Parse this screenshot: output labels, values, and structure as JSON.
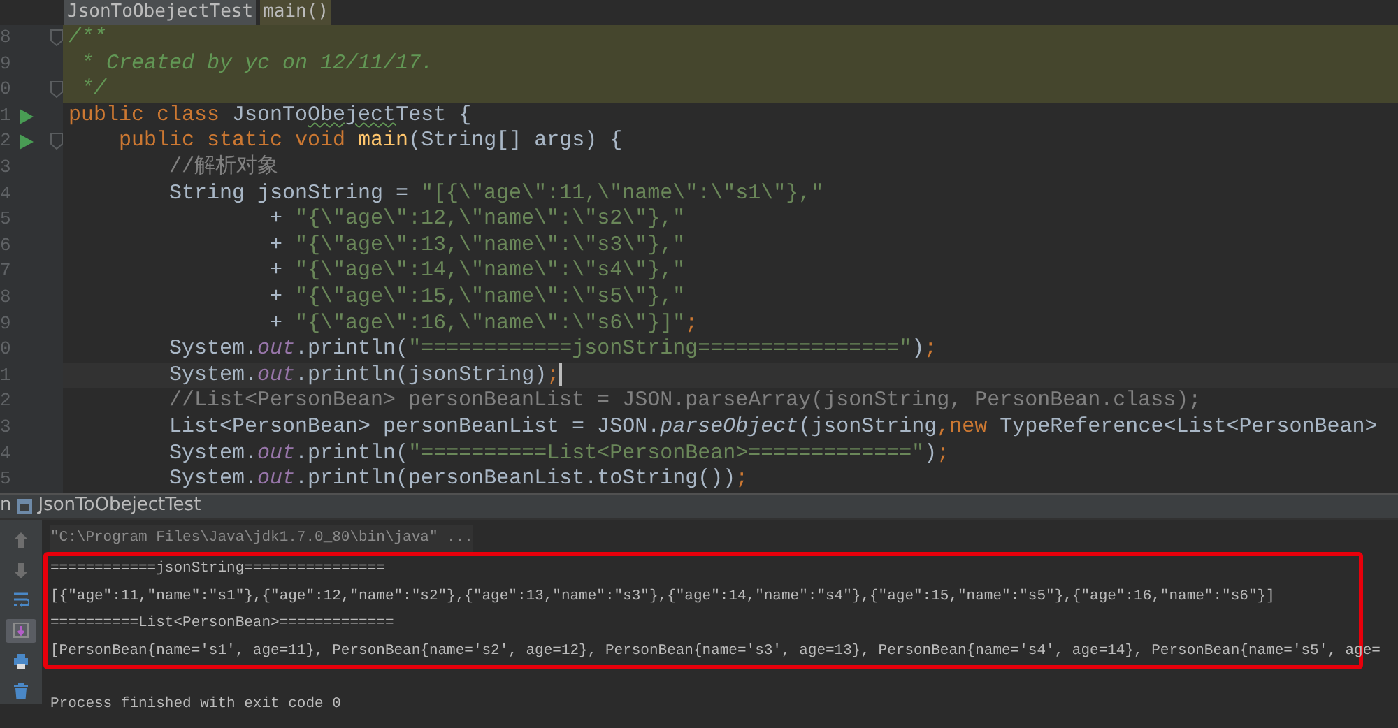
{
  "breadcrumbs": [
    {
      "label": "JsonToObejectTest",
      "kind": "class"
    },
    {
      "label": "main()",
      "kind": "method"
    }
  ],
  "editor": {
    "lines": [
      {
        "number": "8",
        "highlighted": true,
        "current": false,
        "run_marker": false,
        "fold": true,
        "tokens": [
          {
            "text": "/**",
            "kind": "doc"
          }
        ]
      },
      {
        "number": "9",
        "highlighted": true,
        "current": false,
        "run_marker": false,
        "fold": false,
        "tokens": [
          {
            "text": " * Created by yc on 12/11/17.",
            "kind": "doc"
          }
        ]
      },
      {
        "number": "0",
        "highlighted": true,
        "current": false,
        "run_marker": false,
        "fold": true,
        "tokens": [
          {
            "text": " */",
            "kind": "doc"
          }
        ]
      },
      {
        "number": "1",
        "highlighted": false,
        "current": false,
        "run_marker": true,
        "fold": false,
        "tokens": [
          {
            "text": "public class ",
            "kind": "keyword"
          },
          {
            "text": "JsonTo",
            "kind": "plain"
          },
          {
            "text": "Obeject",
            "kind": "typo"
          },
          {
            "text": "Test {",
            "kind": "plain"
          }
        ]
      },
      {
        "number": "2",
        "highlighted": false,
        "current": false,
        "run_marker": true,
        "fold": true,
        "tokens": [
          {
            "text": "    public static void ",
            "kind": "keyword"
          },
          {
            "text": "main",
            "kind": "function"
          },
          {
            "text": "(String[] args) {",
            "kind": "plain"
          }
        ]
      },
      {
        "number": "3",
        "highlighted": false,
        "current": false,
        "run_marker": false,
        "fold": false,
        "tokens": [
          {
            "text": "        //解析对象",
            "kind": "comment"
          }
        ]
      },
      {
        "number": "4",
        "highlighted": false,
        "current": false,
        "run_marker": false,
        "fold": false,
        "tokens": [
          {
            "text": "        String jsonString = ",
            "kind": "plain"
          },
          {
            "text": "\"[{\\\"age\\\":11,\\\"name\\\":\\\"s1\\\"},\"",
            "kind": "string"
          }
        ]
      },
      {
        "number": "5",
        "highlighted": false,
        "current": false,
        "run_marker": false,
        "fold": false,
        "tokens": [
          {
            "text": "                + ",
            "kind": "plain"
          },
          {
            "text": "\"{\\\"age\\\":12,\\\"name\\\":\\\"s2\\\"},\"",
            "kind": "string"
          }
        ]
      },
      {
        "number": "6",
        "highlighted": false,
        "current": false,
        "run_marker": false,
        "fold": false,
        "tokens": [
          {
            "text": "                + ",
            "kind": "plain"
          },
          {
            "text": "\"{\\\"age\\\":13,\\\"name\\\":\\\"s3\\\"},\"",
            "kind": "string"
          }
        ]
      },
      {
        "number": "7",
        "highlighted": false,
        "current": false,
        "run_marker": false,
        "fold": false,
        "tokens": [
          {
            "text": "                + ",
            "kind": "plain"
          },
          {
            "text": "\"{\\\"age\\\":14,\\\"name\\\":\\\"s4\\\"},\"",
            "kind": "string"
          }
        ]
      },
      {
        "number": "8",
        "highlighted": false,
        "current": false,
        "run_marker": false,
        "fold": false,
        "tokens": [
          {
            "text": "                + ",
            "kind": "plain"
          },
          {
            "text": "\"{\\\"age\\\":15,\\\"name\\\":\\\"s5\\\"},\"",
            "kind": "string"
          }
        ]
      },
      {
        "number": "9",
        "highlighted": false,
        "current": false,
        "run_marker": false,
        "fold": false,
        "tokens": [
          {
            "text": "                + ",
            "kind": "plain"
          },
          {
            "text": "\"{\\\"age\\\":16,\\\"name\\\":\\\"s6\\\"}]\"",
            "kind": "string"
          },
          {
            "text": ";",
            "kind": "keyword"
          }
        ]
      },
      {
        "number": "0",
        "highlighted": false,
        "current": false,
        "run_marker": false,
        "fold": false,
        "tokens": [
          {
            "text": "        System.",
            "kind": "plain"
          },
          {
            "text": "out",
            "kind": "field"
          },
          {
            "text": ".println(",
            "kind": "plain"
          },
          {
            "text": "\"============jsonString================\"",
            "kind": "string"
          },
          {
            "text": ")",
            "kind": "plain"
          },
          {
            "text": ";",
            "kind": "keyword"
          }
        ]
      },
      {
        "number": "1",
        "highlighted": false,
        "current": true,
        "run_marker": false,
        "fold": false,
        "tokens": [
          {
            "text": "        System.",
            "kind": "plain"
          },
          {
            "text": "out",
            "kind": "field"
          },
          {
            "text": ".println(jsonString)",
            "kind": "plain"
          },
          {
            "text": ";",
            "kind": "keyword"
          }
        ]
      },
      {
        "number": "2",
        "highlighted": false,
        "current": false,
        "run_marker": false,
        "fold": false,
        "tokens": [
          {
            "text": "        //List<PersonBean> personBeanList = JSON.parseArray(jsonString, PersonBean.class);",
            "kind": "comment"
          }
        ]
      },
      {
        "number": "3",
        "highlighted": false,
        "current": false,
        "run_marker": false,
        "fold": false,
        "tokens": [
          {
            "text": "        List<PersonBean> personBeanList = JSON.",
            "kind": "plain"
          },
          {
            "text": "parseObject",
            "kind": "static"
          },
          {
            "text": "(jsonString",
            "kind": "plain"
          },
          {
            "text": ",",
            "kind": "keyword"
          },
          {
            "text": "new ",
            "kind": "keyword"
          },
          {
            "text": "TypeReference<List<PersonBean>",
            "kind": "plain"
          }
        ]
      },
      {
        "number": "4",
        "highlighted": false,
        "current": false,
        "run_marker": false,
        "fold": false,
        "tokens": [
          {
            "text": "        System.",
            "kind": "plain"
          },
          {
            "text": "out",
            "kind": "field"
          },
          {
            "text": ".println(",
            "kind": "plain"
          },
          {
            "text": "\"==========List<PersonBean>=============\"",
            "kind": "string"
          },
          {
            "text": ")",
            "kind": "plain"
          },
          {
            "text": ";",
            "kind": "keyword"
          }
        ]
      },
      {
        "number": "5",
        "highlighted": false,
        "current": false,
        "run_marker": false,
        "fold": false,
        "tokens": [
          {
            "text": "        System.",
            "kind": "plain"
          },
          {
            "text": "out",
            "kind": "field"
          },
          {
            "text": ".println(personBeanList.toString())",
            "kind": "plain"
          },
          {
            "text": ";",
            "kind": "keyword"
          }
        ]
      }
    ]
  },
  "run_panel": {
    "tab_label": "n",
    "title": "JsonToObejectTest",
    "toolbar": [
      {
        "kind": "up",
        "selected": false
      },
      {
        "kind": "down",
        "selected": false
      },
      {
        "kind": "wrap",
        "selected": false
      },
      {
        "kind": "scroll-end",
        "selected": true
      },
      {
        "kind": "print",
        "selected": false
      },
      {
        "kind": "trash",
        "selected": false
      }
    ],
    "console": [
      {
        "kind": "command",
        "framed": false,
        "text": "\"C:\\Program Files\\Java\\jdk1.7.0_80\\bin\\java\" ..."
      },
      {
        "kind": "output",
        "framed": true,
        "text": "============jsonString================"
      },
      {
        "kind": "output",
        "framed": true,
        "text": "[{\"age\":11,\"name\":\"s1\"},{\"age\":12,\"name\":\"s2\"},{\"age\":13,\"name\":\"s3\"},{\"age\":14,\"name\":\"s4\"},{\"age\":15,\"name\":\"s5\"},{\"age\":16,\"name\":\"s6\"}]"
      },
      {
        "kind": "output",
        "framed": true,
        "text": "==========List<PersonBean>============="
      },
      {
        "kind": "output",
        "framed": true,
        "text": "[PersonBean{name='s1', age=11}, PersonBean{name='s2', age=12}, PersonBean{name='s3', age=13}, PersonBean{name='s4', age=14}, PersonBean{name='s5', age="
      },
      {
        "kind": "output",
        "framed": false,
        "text": "Process finished with exit code 0"
      }
    ]
  }
}
